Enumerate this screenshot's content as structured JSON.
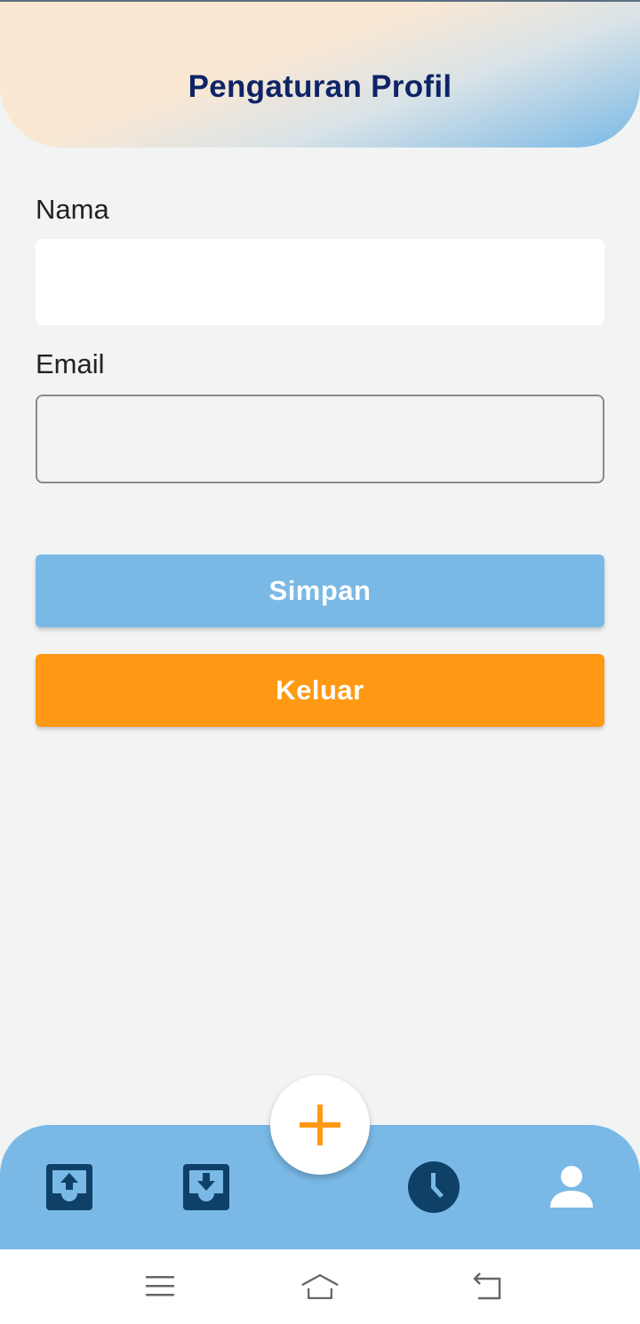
{
  "header": {
    "title": "Pengaturan Profil"
  },
  "form": {
    "name_label": "Nama",
    "name_value": "",
    "email_label": "Email",
    "email_value": ""
  },
  "buttons": {
    "save_label": "Simpan",
    "logout_label": "Keluar"
  },
  "bottom_nav": {
    "items": [
      {
        "icon": "upload-tray-icon",
        "active": false
      },
      {
        "icon": "download-tray-icon",
        "active": false
      },
      {
        "icon": "add-icon",
        "role": "fab"
      },
      {
        "icon": "clock-icon",
        "active": false
      },
      {
        "icon": "person-icon",
        "active": true
      }
    ]
  },
  "system_nav": {
    "icons": [
      "menu-icon",
      "home-icon",
      "back-icon"
    ]
  },
  "colors": {
    "primary_blue": "#7ab9e6",
    "accent_orange": "#ff9913",
    "title_navy": "#0f2466",
    "icon_navy": "#0e4068",
    "background": "#f2f3f3"
  }
}
